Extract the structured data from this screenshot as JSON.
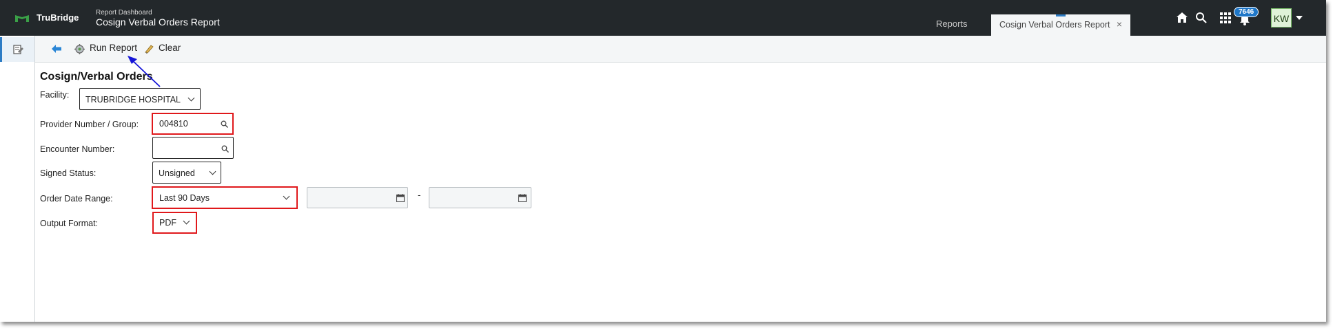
{
  "header": {
    "brand": "TruBridge",
    "breadcrumb_small": "Report Dashboard",
    "breadcrumb_title": "Cosign Verbal Orders Report",
    "tab_reports": "Reports",
    "tab_active": "Cosign Verbal Orders Report",
    "tab_close": "×",
    "notification_count": "7646",
    "avatar_initials": "KW"
  },
  "toolbar": {
    "run_report_label": "Run Report",
    "clear_label": "Clear"
  },
  "form": {
    "title": "Cosign/Verbal Orders",
    "facility_label": "Facility:",
    "facility_value": "TRUBRIDGE HOSPITAL",
    "provider_label": "Provider Number / Group:",
    "provider_value": "004810",
    "encounter_label": "Encounter Number:",
    "encounter_value": "",
    "signed_label": "Signed Status:",
    "signed_value": "Unsigned",
    "date_range_label": "Order Date Range:",
    "date_range_value": "Last 90 Days",
    "date_separator": "-",
    "output_label": "Output Format:",
    "output_value": "PDF"
  },
  "colors": {
    "header_bg": "#23282b",
    "accent": "#2d7cc4",
    "highlight": "#e0181b",
    "annotation_arrow": "#1515d8"
  }
}
